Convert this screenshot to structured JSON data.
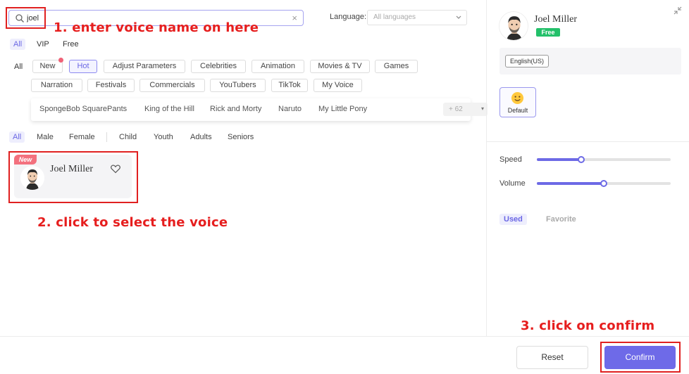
{
  "search": {
    "value": "joel",
    "clear_icon": "×"
  },
  "language": {
    "label": "Language:",
    "placeholder": "All languages"
  },
  "tiers": [
    "All",
    "VIP",
    "Free"
  ],
  "category_all": "All",
  "categories_row1": [
    "New",
    "Hot",
    "Adjust Parameters",
    "Celebrities",
    "Animation",
    "Movies & TV",
    "Games"
  ],
  "categories_row2": [
    "Narration",
    "Festivals",
    "Commercials",
    "YouTubers",
    "TikTok",
    "My Voice"
  ],
  "subcategories": [
    "SpongeBob SquarePants",
    "King of the Hill",
    "Rick and Morty",
    "Naruto",
    "My Little Pony"
  ],
  "more": {
    "label": "+ 62",
    "icon": "▾"
  },
  "filters": [
    "All",
    "Male",
    "Female",
    "Child",
    "Youth",
    "Adults",
    "Seniors"
  ],
  "voice_card": {
    "badge": "New",
    "name": "Joel Miller",
    "icons": [
      "avatar",
      "heart-icon"
    ]
  },
  "detail": {
    "name": "Joel Miller",
    "badge": "Free",
    "language_tag": "English(US)",
    "style_label": "Default",
    "speed_label": "Speed",
    "speed_value": 0.33,
    "volume_label": "Volume",
    "volume_value": 0.5,
    "tabs": [
      "Used",
      "Favorite"
    ]
  },
  "annotations": {
    "step1": "1. enter voice name on here",
    "step2": "2. click to select the voice",
    "step3": "3. click on confirm"
  },
  "footer": {
    "reset": "Reset",
    "confirm": "Confirm"
  },
  "colors": {
    "accent": "#6e6ae8",
    "annotation": "#e61e1e",
    "free_badge": "#23c06a",
    "new_badge": "#f3717e"
  }
}
